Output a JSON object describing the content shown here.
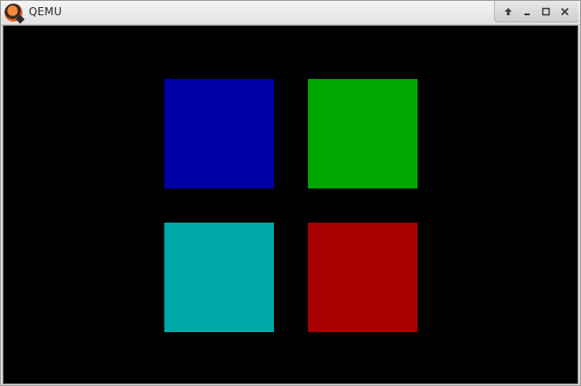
{
  "window": {
    "title": "QEMU",
    "controls": [
      "up-arrow-icon",
      "minimize-icon",
      "maximize-icon",
      "close-icon"
    ]
  },
  "screen": {
    "background": "#000000",
    "squares": [
      {
        "name": "blue",
        "color": "#0000a8"
      },
      {
        "name": "green",
        "color": "#00a800"
      },
      {
        "name": "cyan",
        "color": "#00a8a8"
      },
      {
        "name": "red",
        "color": "#a80000"
      }
    ]
  }
}
